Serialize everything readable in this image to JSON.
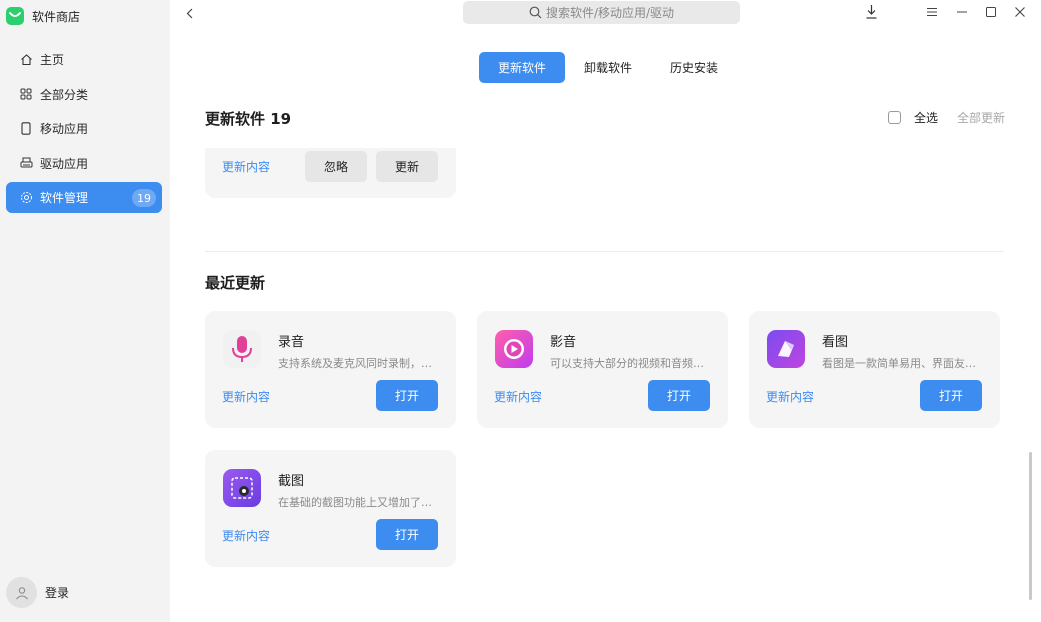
{
  "app": {
    "title": "软件商店"
  },
  "sidebar": {
    "items": [
      {
        "label": "主页",
        "icon": "home-icon"
      },
      {
        "label": "全部分类",
        "icon": "grid-icon"
      },
      {
        "label": "移动应用",
        "icon": "phone-icon"
      },
      {
        "label": "驱动应用",
        "icon": "printer-icon"
      },
      {
        "label": "软件管理",
        "icon": "gear-icon",
        "badge": "19",
        "active": true
      }
    ],
    "login_label": "登录"
  },
  "search": {
    "placeholder": "搜索软件/移动应用/驱动"
  },
  "tabs": [
    {
      "label": "更新软件",
      "active": true
    },
    {
      "label": "卸载软件"
    },
    {
      "label": "历史安装"
    }
  ],
  "updates": {
    "title": "更新软件 19",
    "select_all_label": "全选",
    "update_all_label": "全部更新",
    "partial_card": {
      "link_label": "更新内容",
      "ignore_label": "忽略",
      "update_label": "更新"
    }
  },
  "recent": {
    "title": "最近更新",
    "apps": [
      {
        "name": "录音",
        "desc": "支持系统及麦克风同时录制，…",
        "link_label": "更新内容",
        "button_label": "打开",
        "icon": "microphone-icon"
      },
      {
        "name": "影音",
        "desc": "可以支持大部分的视频和音频…",
        "link_label": "更新内容",
        "button_label": "打开",
        "icon": "play-icon"
      },
      {
        "name": "看图",
        "desc": "看图是一款简单易用、界面友…",
        "link_label": "更新内容",
        "button_label": "打开",
        "icon": "image-viewer-icon"
      },
      {
        "name": "截图",
        "desc": "在基础的截图功能上又增加了…",
        "link_label": "更新内容",
        "button_label": "打开",
        "icon": "camera-icon"
      }
    ]
  },
  "colors": {
    "accent": "#3d8cf0",
    "sidebar_bg": "#f3f3f3",
    "card_bg": "#f5f5f5"
  }
}
